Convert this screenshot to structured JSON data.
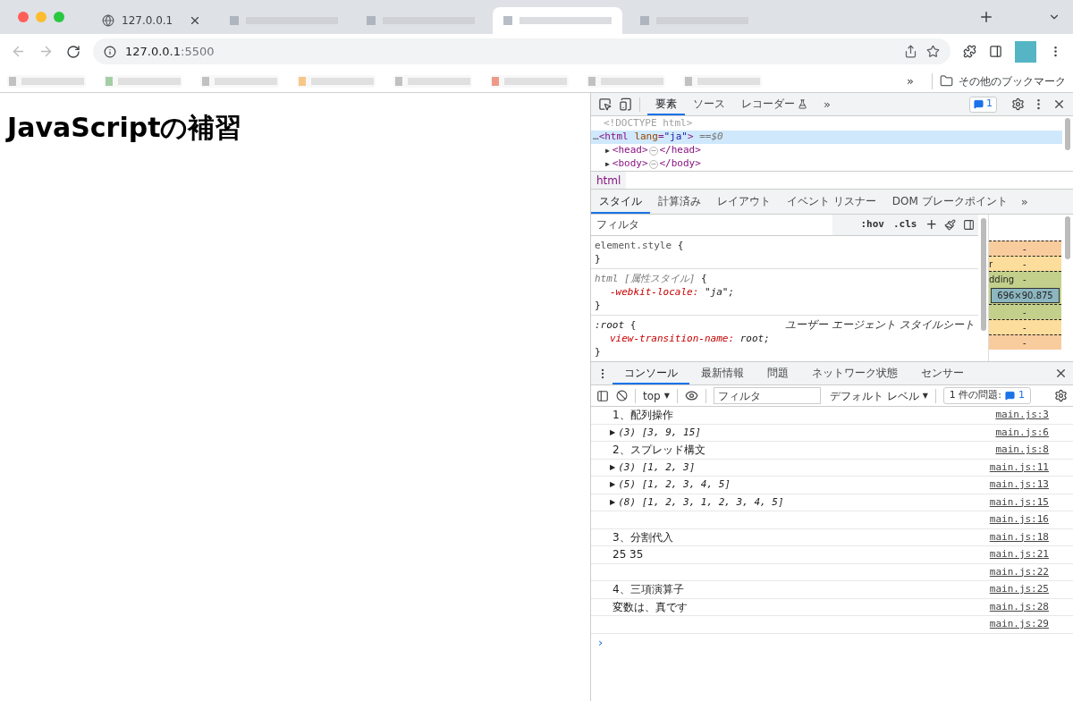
{
  "browser": {
    "tabs": [
      {
        "kind": "page",
        "label": "127.0.0.1",
        "selected": false
      },
      {
        "kind": "blurred",
        "selected": false
      },
      {
        "kind": "blurred",
        "selected": false
      },
      {
        "kind": "blurred",
        "selected": true
      },
      {
        "kind": "blurred",
        "selected": false
      }
    ],
    "address": {
      "host": "127.0.0.1",
      "port": ":5500"
    },
    "bookmarks_overflow": "»",
    "other_bookmarks": "その他のブックマーク"
  },
  "page": {
    "heading": "JavaScriptの補習"
  },
  "devtools": {
    "tabs": [
      {
        "label": "要素",
        "selected": true
      },
      {
        "label": "ソース",
        "selected": false
      },
      {
        "label": "レコーダー",
        "selected": false
      }
    ],
    "tabs_overflow": "»",
    "issues_count": "1",
    "dom": [
      {
        "kind": "doctype",
        "text": "<!DOCTYPE html>",
        "selected": false
      },
      {
        "kind": "open",
        "prefix": "…",
        "tag": "<html",
        "attr": "lang",
        "eq": "=",
        "value": "\"ja\"",
        "end": ">",
        "note_op": "==",
        "note": "$0",
        "selected": true
      },
      {
        "kind": "collapsed",
        "toggle": "▶",
        "tag": "<head>",
        "ellipsis": "⋯",
        "close": "</head>",
        "selected": false
      },
      {
        "kind": "collapsed",
        "toggle": "▶",
        "tag": "<body>",
        "ellipsis": "⋯",
        "close": "</body>",
        "selected": false
      }
    ],
    "breadcrumb": "html",
    "style_tabs": [
      {
        "label": "スタイル",
        "selected": true
      },
      {
        "label": "計算済み",
        "selected": false
      },
      {
        "label": "レイアウト",
        "selected": false
      },
      {
        "label": "イベント リスナー",
        "selected": false
      },
      {
        "label": "DOM ブレークポイント",
        "selected": false
      }
    ],
    "style_tabs_overflow": "»",
    "styles_filter": {
      "placeholder": "フィルタ"
    },
    "hov": ":hov",
    "cls": ".cls",
    "add": "+",
    "rules": [
      {
        "kind": "inline",
        "selector": "element.style",
        "open": "{",
        "close": "}"
      },
      {
        "kind": "attribute",
        "selector": "html",
        "tag": "[属性スタイル]",
        "open": "{",
        "close": "}",
        "declarations": [
          {
            "property": "-webkit-locale:",
            "value": "\"ja\";"
          }
        ]
      },
      {
        "kind": "agent",
        "selector": ":root",
        "origin": "ユーザー エージェント スタイルシート",
        "open": "{",
        "close": "}",
        "declarations": [
          {
            "property": "view-transition-name:",
            "value": "root;"
          }
        ]
      }
    ],
    "box_model": [
      {
        "value": "-",
        "color": "#f9cc9d"
      },
      {
        "label": "r",
        "value": "-",
        "color": "#fddd9b"
      },
      {
        "label": "dding",
        "value": "-",
        "color": "#c3d08b"
      },
      {
        "kind": "content",
        "value": "696×90.875",
        "color": "#8cb6c0"
      },
      {
        "value": "-",
        "color": "#c3d08b"
      },
      {
        "value": "-",
        "color": "#fddd9b"
      },
      {
        "value": "-",
        "color": "#f9cc9d"
      }
    ]
  },
  "console": {
    "tabs": [
      {
        "label": "コンソール",
        "selected": true
      },
      {
        "label": "最新情報",
        "selected": false
      },
      {
        "label": "問題",
        "selected": false
      },
      {
        "label": "ネットワーク状態",
        "selected": false
      },
      {
        "label": "センサー",
        "selected": false
      }
    ],
    "context": "top",
    "context_caret": "▼",
    "filter": {
      "placeholder": "フィルタ"
    },
    "levels": "デフォルト レベル",
    "levels_caret": "▼",
    "issues_label": "1 件の問題:",
    "issues_count": "1",
    "messages": [
      {
        "kind": "text",
        "text": "1、配列操作",
        "source": "main.js:3"
      },
      {
        "kind": "array",
        "toggle": "▶",
        "text": "(3) [3, 9, 15]",
        "source": "main.js:6"
      },
      {
        "kind": "text",
        "text": "2、スプレッド構文",
        "source": "main.js:8"
      },
      {
        "kind": "array",
        "toggle": "▶",
        "text": "(3) [1, 2, 3]",
        "source": "main.js:11"
      },
      {
        "kind": "array",
        "toggle": "▶",
        "text": "(5) [1, 2, 3, 4, 5]",
        "source": "main.js:13"
      },
      {
        "kind": "array",
        "toggle": "▶",
        "text": "(8) [1, 2, 3, 1, 2, 3, 4, 5]",
        "source": "main.js:15"
      },
      {
        "kind": "empty",
        "source": "main.js:16"
      },
      {
        "kind": "text",
        "text": "3、分割代入",
        "source": "main.js:18"
      },
      {
        "kind": "text",
        "text": "25 35",
        "source": "main.js:21"
      },
      {
        "kind": "empty",
        "source": "main.js:22"
      },
      {
        "kind": "text",
        "text": "4、三項演算子",
        "source": "main.js:25"
      },
      {
        "kind": "text",
        "text": "変数は、真です",
        "source": "main.js:28"
      },
      {
        "kind": "empty",
        "source": "main.js:29"
      }
    ],
    "prompt": "›"
  }
}
